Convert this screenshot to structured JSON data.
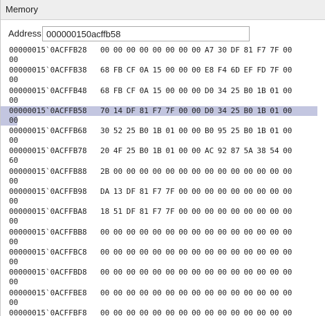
{
  "window": {
    "title": "Memory"
  },
  "address": {
    "label": "Address:",
    "value": "000000150acffb58"
  },
  "rows": [
    {
      "addr": "00000015`0ACFFB28",
      "bytes": "00 00 00 00 00 00 00 00 A7 30 DF 81 F7 7F 00",
      "tail": "00",
      "selected": false
    },
    {
      "addr": "00000015`0ACFFB38",
      "bytes": "68 FB CF 0A 15 00 00 00 E8 F4 6D EF FD 7F 00",
      "tail": "00",
      "selected": false
    },
    {
      "addr": "00000015`0ACFFB48",
      "bytes": "68 FB CF 0A 15 00 00 00 D0 34 25 B0 1B 01 00",
      "tail": "00",
      "selected": false
    },
    {
      "addr": "00000015`0ACFFB58",
      "bytes": "70 14 DF 81 F7 7F 00 00 D0 34 25 B0 1B 01 00",
      "tail": "00",
      "selected": true
    },
    {
      "addr": "00000015`0ACFFB68",
      "bytes": "30 52 25 B0 1B 01 00 00 B0 95 25 B0 1B 01 00",
      "tail": "00",
      "selected": false
    },
    {
      "addr": "00000015`0ACFFB78",
      "bytes": "20 4F 25 B0 1B 01 00 00 AC 92 87 5A 38 54 00",
      "tail": "60",
      "selected": false
    },
    {
      "addr": "00000015`0ACFFB88",
      "bytes": "2B 00 00 00 00 00 00 00 00 00 00 00 00 00 00",
      "tail": "00",
      "selected": false
    },
    {
      "addr": "00000015`0ACFFB98",
      "bytes": "DA 13 DF 81 F7 7F 00 00 00 00 00 00 00 00 00",
      "tail": "00",
      "selected": false
    },
    {
      "addr": "00000015`0ACFFBA8",
      "bytes": "18 51 DF 81 F7 7F 00 00 00 00 00 00 00 00 00",
      "tail": "00",
      "selected": false
    },
    {
      "addr": "00000015`0ACFFBB8",
      "bytes": "00 00 00 00 00 00 00 00 00 00 00 00 00 00 00",
      "tail": "00",
      "selected": false
    },
    {
      "addr": "00000015`0ACFFBC8",
      "bytes": "00 00 00 00 00 00 00 00 00 00 00 00 00 00 00",
      "tail": "00",
      "selected": false
    },
    {
      "addr": "00000015`0ACFFBD8",
      "bytes": "00 00 00 00 00 00 00 00 00 00 00 00 00 00 00",
      "tail": "00",
      "selected": false
    },
    {
      "addr": "00000015`0ACFFBE8",
      "bytes": "00 00 00 00 00 00 00 00 00 00 00 00 00 00 00",
      "tail": "00",
      "selected": false
    },
    {
      "addr": "00000015`0ACFFBF8",
      "bytes": "00 00 00 00 00 00 00 00 00 00 00 00 00 00 00",
      "tail": "00",
      "selected": false
    }
  ],
  "colors": {
    "selection": "#c3c6e0",
    "titlebar": "#eeeeee"
  }
}
